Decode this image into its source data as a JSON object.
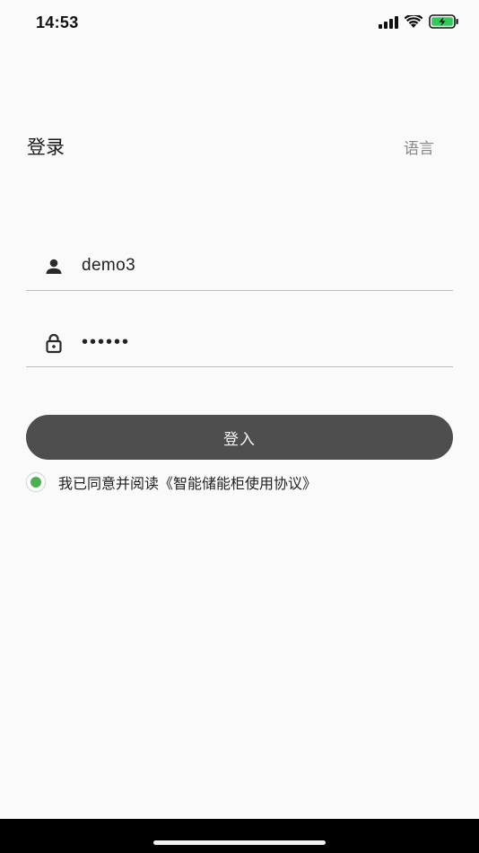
{
  "status_bar": {
    "time": "14:53",
    "icons": [
      "cellular-signal-icon",
      "wifi-icon",
      "battery-charging-icon"
    ],
    "battery_color": "#34c759"
  },
  "header": {
    "title": "登录",
    "language_label": "语言"
  },
  "form": {
    "username": {
      "icon": "user-icon",
      "value": "demo3"
    },
    "password": {
      "icon": "lock-icon",
      "value": "••••••"
    },
    "login_label": "登入"
  },
  "agreement": {
    "checked": true,
    "text": "我已同意并阅读",
    "link_label": "《智能储能柜使用协议》",
    "check_color": "#4caf50"
  },
  "colors": {
    "background": "#fafafa",
    "button": "#4e4e4e",
    "accent": "#4caf50"
  }
}
